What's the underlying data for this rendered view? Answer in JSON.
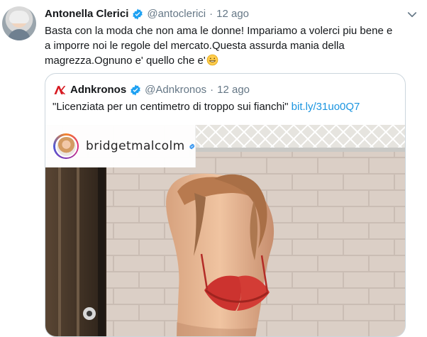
{
  "tweet": {
    "author_name": "Antonella Clerici",
    "handle": "@antoclerici",
    "separator": "·",
    "date": "12 ago",
    "text": "Basta con la moda che non ama le donne! Impariamo a volerci piu bene e\na imporre noi le regole del mercato.Questa assurda mania della\nmagrezza.Ognuno e' quello che e'",
    "verified_icon": "verified-badge-icon",
    "menu_icon": "chevron-down-icon",
    "emoji": "grinning-face-icon"
  },
  "quoted_tweet": {
    "author_name": "Adnkronos",
    "handle": "@Adnkronos",
    "separator": "·",
    "date": "12 ago",
    "text": "\"Licenziata per un centimetro di troppo sui fianchi\"",
    "link": "bit.ly/31uo0Q7",
    "logo_icon": "adnkronos-logo-icon"
  },
  "media": {
    "profile_username": "bridgetmalcolm",
    "verified_icon": "instagram-verified-icon"
  },
  "colors": {
    "twitter_blue": "#1da1f2",
    "link_blue": "#1b95e0",
    "muted_gray": "#657786",
    "border_gray": "#ccd6dd",
    "adnkronos_red": "#d71920"
  }
}
